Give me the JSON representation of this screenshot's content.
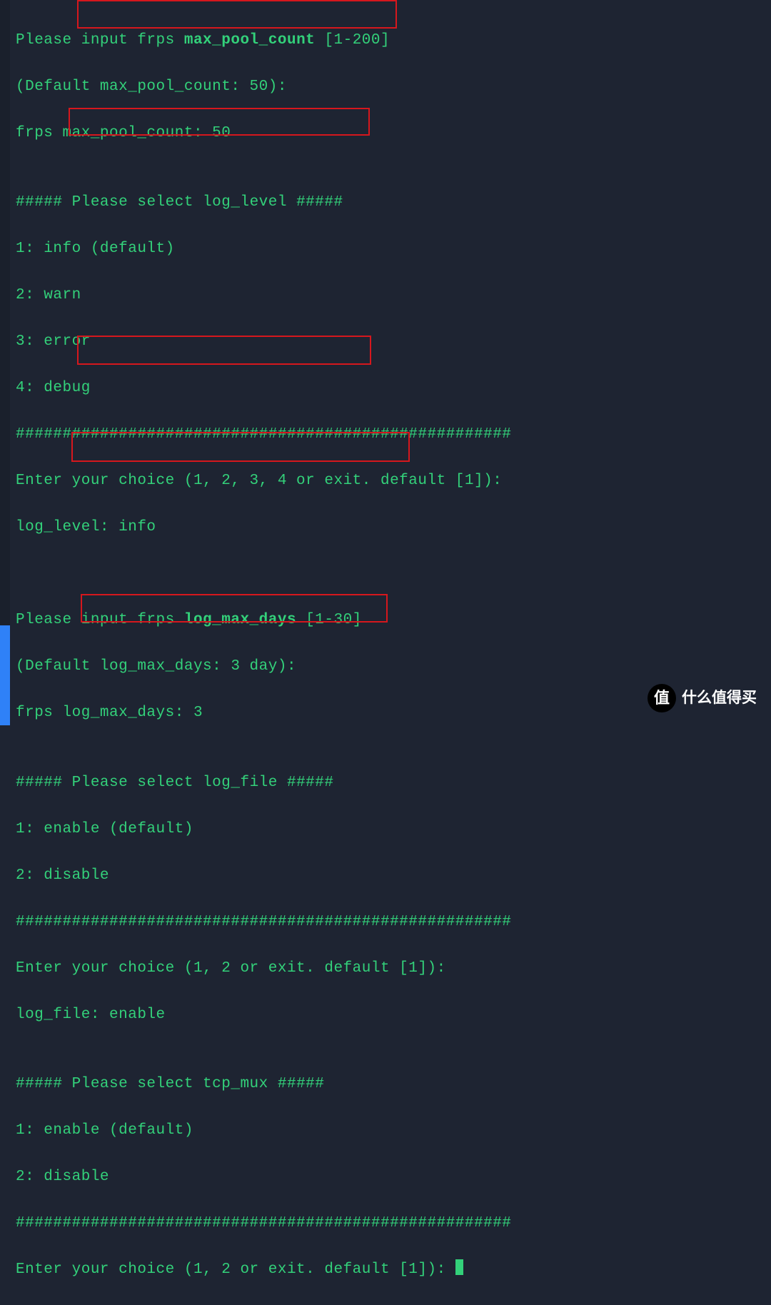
{
  "lines": {
    "l1a": "Please ",
    "l1b": "input frps ",
    "l1c": "max_pool_count",
    "l1d": " [1-200]",
    "l2": "(Default max_pool_count: 50):",
    "l3": "frps max_pool_count: 50",
    "l4": "",
    "l5a": "##### ",
    "l5b": "Please select log_level #####",
    "l6": "1: info (default)",
    "l7": "2: warn",
    "l8": "3: error",
    "l9": "4: debug",
    "l10": "#####################################################",
    "l11": "Enter your choice (1, 2, 3, 4 or exit. default [1]):",
    "l12": "log_level: info",
    "l13": "",
    "l14": "",
    "l15a": "Please ",
    "l15b": "input frps ",
    "l15c": "log_max_days",
    "l15d": " [1-30]",
    "l16": "(Default log_max_days: 3 day):",
    "l17": "frps log_max_days: 3",
    "l18": "",
    "l19a": "##### ",
    "l19b": "Please select log_file #####",
    "l20": "1: enable (default)",
    "l21": "2: disable",
    "l22": "#####################################################",
    "l23": "Enter your choice (1, 2 or exit. default [1]):",
    "l24": "log_file: enable",
    "l25": "",
    "l26a": "##### P",
    "l26b": "lease select tcp_mux #####",
    "l27": "1: enable (default)",
    "l28": "2: disable",
    "l29": "#####################################################",
    "l30": "Enter your choice (1, 2 or exit. default [1]): "
  },
  "watermark": {
    "icon": "值",
    "text": "什么值得买"
  }
}
